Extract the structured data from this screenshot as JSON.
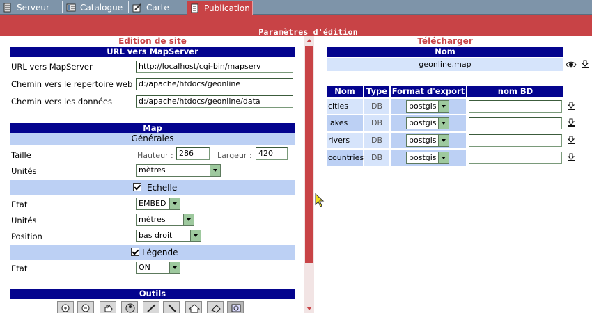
{
  "tabs": [
    {
      "label": "Serveur",
      "icon": "server-icon"
    },
    {
      "label": "Catalogue",
      "icon": "catalog-icon"
    },
    {
      "label": "Carte",
      "icon": "map-edit-icon"
    },
    {
      "label": "Publication",
      "icon": "publish-icon"
    }
  ],
  "active_tab": "Publication",
  "header": {
    "title": "Paramètres d'édition"
  },
  "left": {
    "title": "Edition de site",
    "url_section": {
      "header": "URL vers MapServer",
      "fields": [
        {
          "label": "URL vers MapServer",
          "value": "http://localhost/cgi-bin/mapserv"
        },
        {
          "label": "Chemin vers le repertoire web",
          "value": "d:/apache/htdocs/geonline"
        },
        {
          "label": "Chemin vers les données",
          "value": "d:/apache/htdocs/geonline/data"
        }
      ]
    },
    "map_section": {
      "header": "Map",
      "general_header": "Générales",
      "taille_label": "Taille",
      "hauteur_label": "Hauteur :",
      "hauteur_value": "286",
      "largeur_label": "Largeur :",
      "largeur_value": "420",
      "unites_label": "Unités",
      "unites_value": "mètres",
      "echelle_header": "Echelle",
      "echelle_checked": true,
      "echelle_etat_label": "Etat",
      "echelle_etat_value": "EMBED",
      "echelle_unites_label": "Unités",
      "echelle_unites_value": "mètres",
      "position_label": "Position",
      "position_value": "bas droit",
      "legende_header": "Légende",
      "legende_checked": true,
      "legende_etat_label": "Etat",
      "legende_etat_value": "ON"
    },
    "tools_header": "Outils",
    "tools": [
      "zoom-in-icon",
      "zoom-out-icon",
      "pan-hand-icon",
      "info-icon",
      "draw-line-icon",
      "measure-icon",
      "home-icon",
      "erase-icon",
      "layers-icon"
    ]
  },
  "right": {
    "title": "Télécharger",
    "map_file": {
      "header": "Nom",
      "name": "geonline.map"
    },
    "layers_table": {
      "headers": [
        "Nom",
        "Type",
        "Format d'export",
        "nom BD"
      ],
      "rows": [
        {
          "name": "cities",
          "type": "DB",
          "format": "postgis",
          "db_name": ""
        },
        {
          "name": "lakes",
          "type": "DB",
          "format": "postgis",
          "db_name": ""
        },
        {
          "name": "rivers",
          "type": "DB",
          "format": "postgis",
          "db_name": ""
        },
        {
          "name": "countries",
          "type": "DB",
          "format": "postgis",
          "db_name": ""
        }
      ]
    }
  },
  "colors": {
    "accent_red": "#c84346",
    "navy": "#04048e",
    "light_blue": "#bcd0f4",
    "tab_bar": "#7e94a9"
  }
}
